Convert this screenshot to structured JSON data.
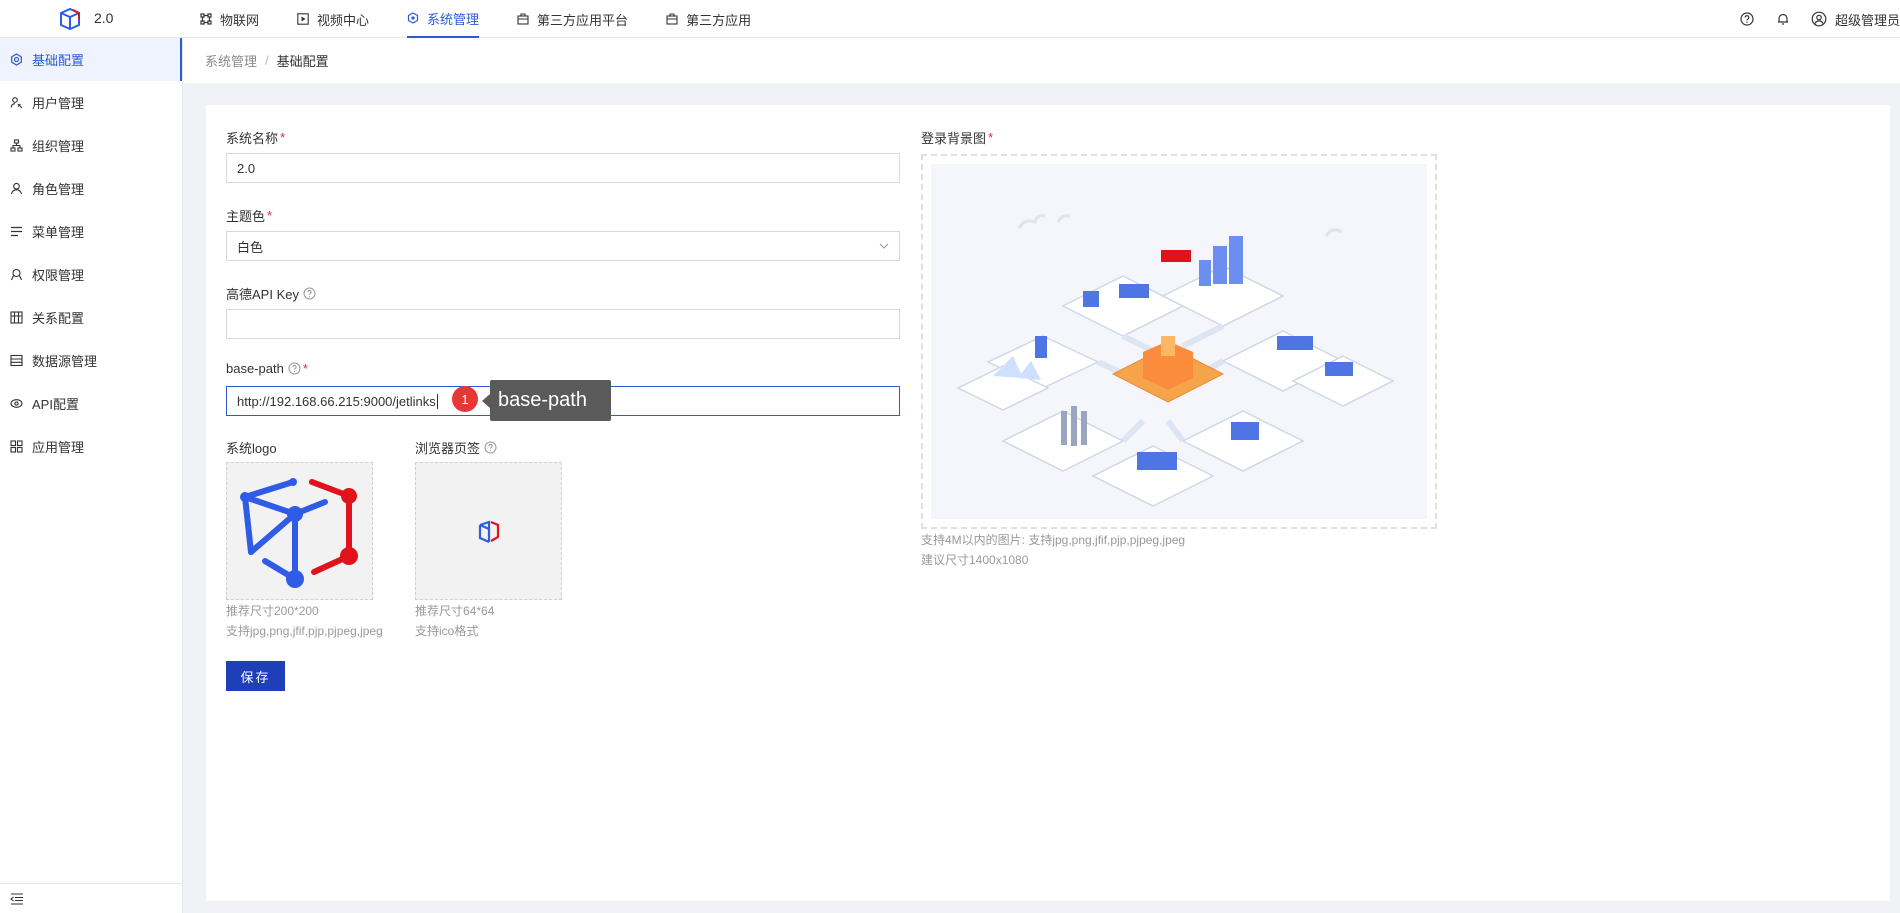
{
  "header": {
    "version": "2.0",
    "nav": [
      {
        "label": "物联网",
        "icon": "iot-icon"
      },
      {
        "label": "视频中心",
        "icon": "video-icon"
      },
      {
        "label": "系统管理",
        "icon": "system-icon",
        "active": true
      },
      {
        "label": "第三方应用平台",
        "icon": "app-platform-icon"
      },
      {
        "label": "第三方应用",
        "icon": "app-icon"
      }
    ],
    "user": "超级管理员"
  },
  "sidebar": {
    "items": [
      {
        "label": "基础配置",
        "icon": "gear-icon",
        "active": true
      },
      {
        "label": "用户管理",
        "icon": "user-icon"
      },
      {
        "label": "组织管理",
        "icon": "org-icon"
      },
      {
        "label": "角色管理",
        "icon": "role-icon"
      },
      {
        "label": "菜单管理",
        "icon": "menu-icon"
      },
      {
        "label": "权限管理",
        "icon": "permission-icon"
      },
      {
        "label": "关系配置",
        "icon": "relation-icon"
      },
      {
        "label": "数据源管理",
        "icon": "datasource-icon"
      },
      {
        "label": "API配置",
        "icon": "api-icon"
      },
      {
        "label": "应用管理",
        "icon": "apps-icon"
      }
    ]
  },
  "breadcrumb": {
    "parent": "系统管理",
    "separator": "/",
    "current": "基础配置"
  },
  "form": {
    "system_name": {
      "label": "系统名称",
      "value": "2.0"
    },
    "theme": {
      "label": "主题色",
      "value": "白色"
    },
    "amap_key": {
      "label": "高德API Key",
      "value": ""
    },
    "base_path": {
      "label": "base-path",
      "value": "http://192.168.66.215:9000/jetlinks"
    },
    "logo": {
      "label": "系统logo",
      "hint1": "推荐尺寸200*200",
      "hint2": "支持jpg,png,jfif,pjp,pjpeg,jpeg"
    },
    "favicon": {
      "label": "浏览器页签",
      "hint1": "推荐尺寸64*64",
      "hint2": "支持ico格式"
    },
    "background": {
      "label": "登录背景图",
      "hint1": "支持4M以内的图片: 支持jpg,png,jfif,pjp,pjpeg,jpeg",
      "hint2": "建议尺寸1400x1080"
    },
    "save_label": "保存"
  },
  "annotation": {
    "badge": "1",
    "text": "base-path"
  },
  "colors": {
    "primary": "#2d59d6",
    "button": "#1f3fb9",
    "required": "#f5222d",
    "logo_blue": "#2f5be6",
    "logo_red": "#e0121c"
  }
}
